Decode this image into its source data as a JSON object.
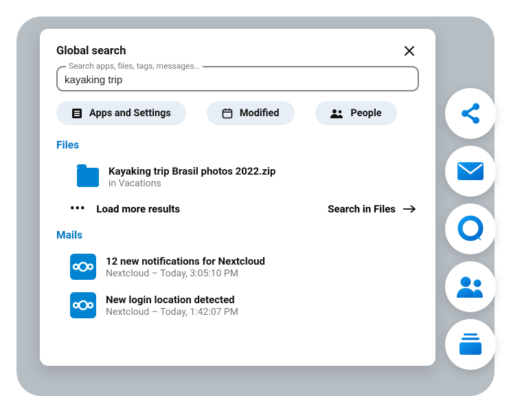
{
  "panel": {
    "title": "Global search",
    "search": {
      "label": "Search apps, files, tags, messages…",
      "value": "kayaking trip"
    },
    "filters": {
      "apps": "Apps and Settings",
      "modified": "Modified",
      "people": "People"
    },
    "files": {
      "heading": "Files",
      "item": {
        "title": "Kayaking trip Brasil photos 2022.zip",
        "subtitle": "in Vacations"
      },
      "load_more": "Load more results",
      "search_in": "Search in Files"
    },
    "mails": {
      "heading": "Mails",
      "items": [
        {
          "title": "12 new notifications for Nextcloud",
          "subtitle": "Nextcloud – Today, 3:05:10 PM"
        },
        {
          "title": "New login location detected",
          "subtitle": "Nextcloud – Today, 1:42:07 PM"
        }
      ]
    }
  },
  "sidebar": {
    "items": [
      "share",
      "mail",
      "talk",
      "contacts",
      "deck"
    ]
  }
}
